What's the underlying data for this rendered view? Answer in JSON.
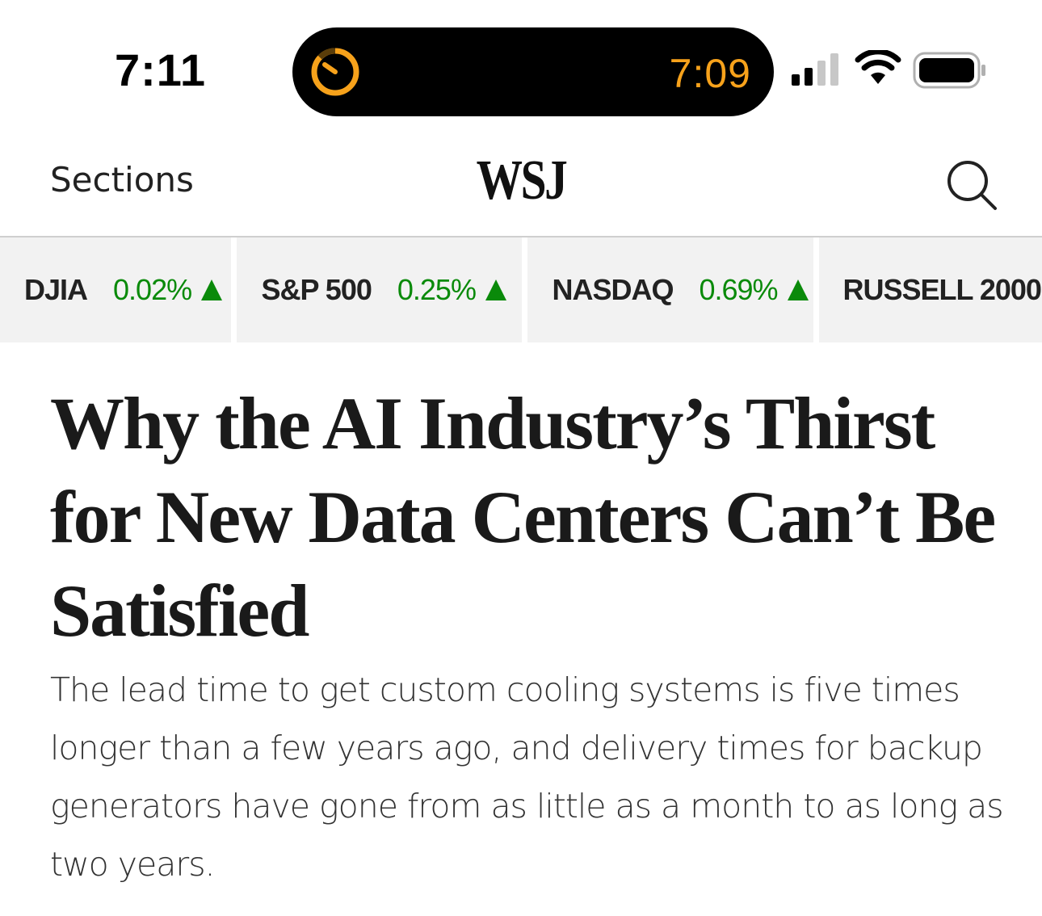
{
  "status_bar": {
    "time": "7:11",
    "island": {
      "icon": "timer-icon",
      "time": "7:09",
      "accent_color": "#f7a21b"
    },
    "signal_icon": "cellular-signal-icon",
    "wifi_icon": "wifi-icon",
    "battery_icon": "battery-icon"
  },
  "nav": {
    "sections_label": "Sections",
    "logo": "WSJ",
    "search_icon": "search-icon"
  },
  "ticker": [
    {
      "name": "DJIA",
      "change": "0.02%",
      "direction": "up"
    },
    {
      "name": "S&P 500",
      "change": "0.25%",
      "direction": "up"
    },
    {
      "name": "NASDAQ",
      "change": "0.69%",
      "direction": "up"
    },
    {
      "name": "RUSSELL 2000",
      "change": "",
      "direction": ""
    }
  ],
  "ticker_up_color": "#0a8a0a",
  "article": {
    "headline": "Why the AI Industry’s Thirst for New Data Centers Can’t Be Satisfied",
    "dek": "The lead time to get custom cooling systems is five times longer than a few years ago, and delivery times for backup generators have gone from as little as a month to as long as two years."
  }
}
